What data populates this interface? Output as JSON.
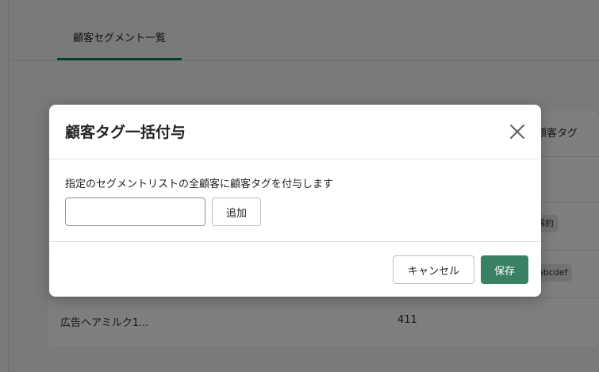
{
  "background": {
    "tab_label": "顧客セグメント一覧",
    "column_header": "顧客タグ",
    "badges": [
      "解約",
      "abcdef"
    ],
    "last_row": {
      "name": "広告ヘアミルク1...",
      "count": "411"
    }
  },
  "modal": {
    "title": "顧客タグ一括付与",
    "description": "指定のセグメントリストの全顧客に顧客タグを付与します",
    "tag_input": {
      "value": "",
      "placeholder": ""
    },
    "add_label": "追加",
    "cancel_label": "キャンセル",
    "save_label": "保存"
  },
  "colors": {
    "primary": "#3a8164",
    "tab_underline": "#008060",
    "overlay": "rgba(0,0,0,0.5)"
  },
  "icons": {
    "close": "close-icon"
  }
}
